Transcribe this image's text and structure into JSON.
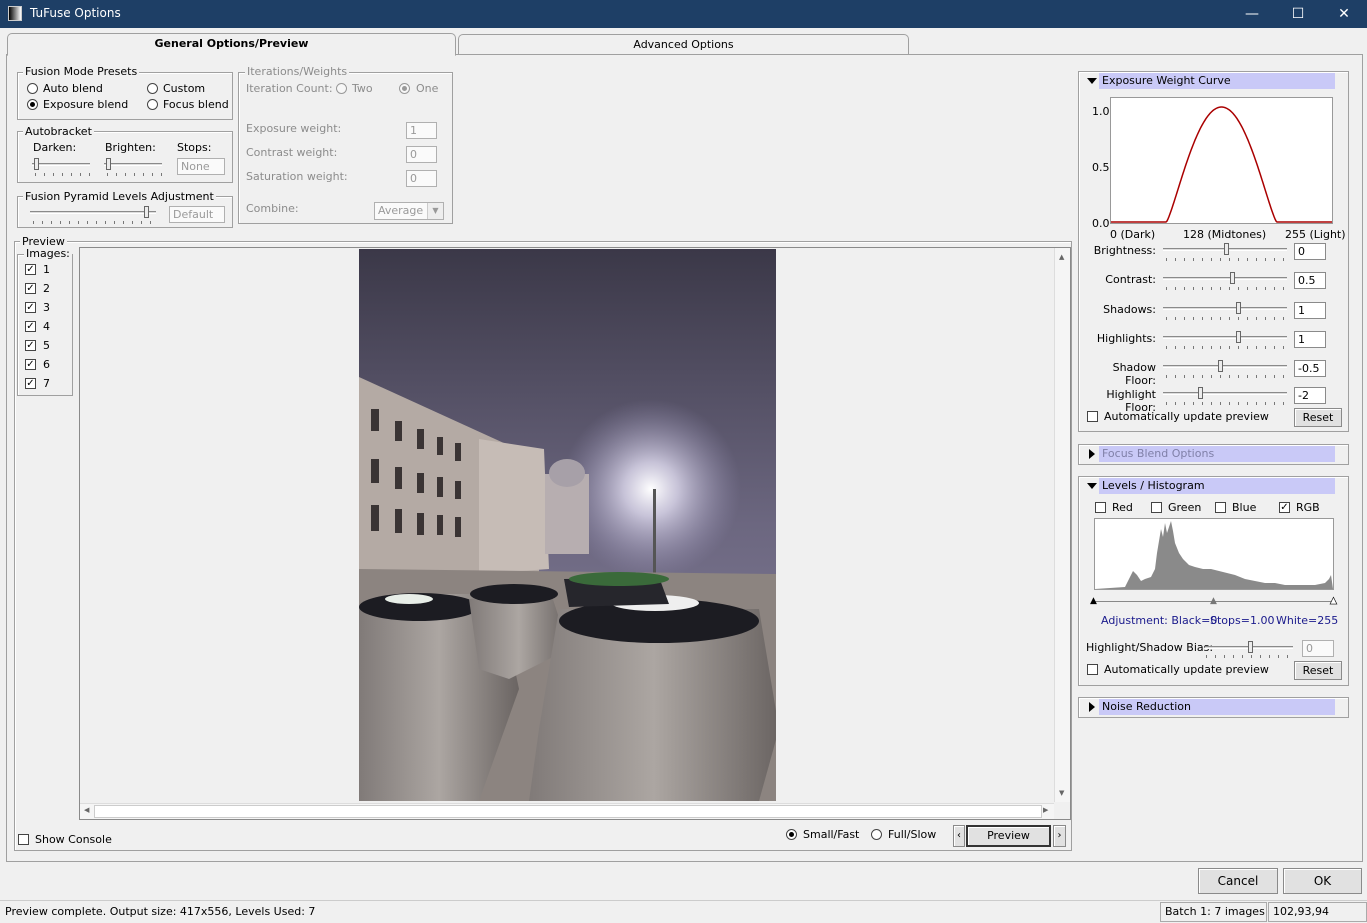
{
  "window": {
    "title": "TuFuse Options",
    "minimize": "—",
    "maximize": "☐",
    "close": "✕"
  },
  "tabs": [
    "General Options/Preview",
    "Advanced Options"
  ],
  "fusion_mode": {
    "title": "Fusion Mode Presets",
    "options": [
      "Auto blend",
      "Custom",
      "Exposure blend",
      "Focus blend"
    ],
    "selected": "Exposure blend"
  },
  "iterations": {
    "title": "Iterations/Weights",
    "count_label": "Iteration Count:",
    "two": "Two",
    "one": "One",
    "exposure_label": "Exposure weight:",
    "exposure_value": "1",
    "contrast_label": "Contrast weight:",
    "contrast_value": "0",
    "saturation_label": "Saturation weight:",
    "saturation_value": "0",
    "combine_label": "Combine:",
    "combine_value": "Average"
  },
  "autobracket": {
    "title": "Autobracket",
    "darken": "Darken:",
    "brighten": "Brighten:",
    "stops": "Stops:",
    "stops_value": "None"
  },
  "pyramid": {
    "title": "Fusion Pyramid Levels Adjustment",
    "value": "Default"
  },
  "preview": {
    "title": "Preview",
    "images_label": "Images:",
    "images": [
      "1",
      "2",
      "3",
      "4",
      "5",
      "6",
      "7"
    ],
    "small_fast": "Small/Fast",
    "full_slow": "Full/Slow",
    "button": "Preview",
    "show_console": "Show Console"
  },
  "exposure_curve": {
    "title": "Exposure Weight Curve",
    "y_ticks": [
      "1.0",
      "0.5",
      "0.0"
    ],
    "x_ticks": [
      "0 (Dark)",
      "128 (Midtones)",
      "255 (Light)"
    ],
    "sliders": [
      {
        "label": "Brightness:",
        "value": "0",
        "pos": 0.52
      },
      {
        "label": "Contrast:",
        "value": "0.5",
        "pos": 0.57
      },
      {
        "label": "Shadows:",
        "value": "1",
        "pos": 0.62
      },
      {
        "label": "Highlights:",
        "value": "1",
        "pos": 0.62
      },
      {
        "label": "Shadow Floor:",
        "value": "-0.5",
        "pos": 0.47
      },
      {
        "label": "Highlight Floor:",
        "value": "-2",
        "pos": 0.3
      }
    ],
    "auto_update": "Automatically update preview",
    "reset": "Reset"
  },
  "focus_blend": {
    "title": "Focus Blend Options"
  },
  "levels": {
    "title": "Levels / Histogram",
    "channels": [
      "Red",
      "Green",
      "Blue",
      "RGB"
    ],
    "adjustment": "Adjustment: Black=0",
    "stops": "Stops=1.00",
    "white": "White=255",
    "bias_label": "Highlight/Shadow Bias:",
    "bias_value": "0",
    "auto_update": "Automatically update preview",
    "reset": "Reset"
  },
  "noise": {
    "title": "Noise Reduction"
  },
  "footer": {
    "cancel": "Cancel",
    "ok": "OK"
  },
  "status": {
    "main": "Preview complete.   Output size: 417x556,   Levels Used: 7",
    "batch": "Batch 1: 7 images",
    "coords": "102,93,94"
  },
  "colors": {
    "title_bar": "#1e3f66",
    "panel_header": "#c9c9f7",
    "curve": "#aa0000",
    "histogram": "#8a8a8a",
    "levels_text": "#1a1a8c"
  }
}
